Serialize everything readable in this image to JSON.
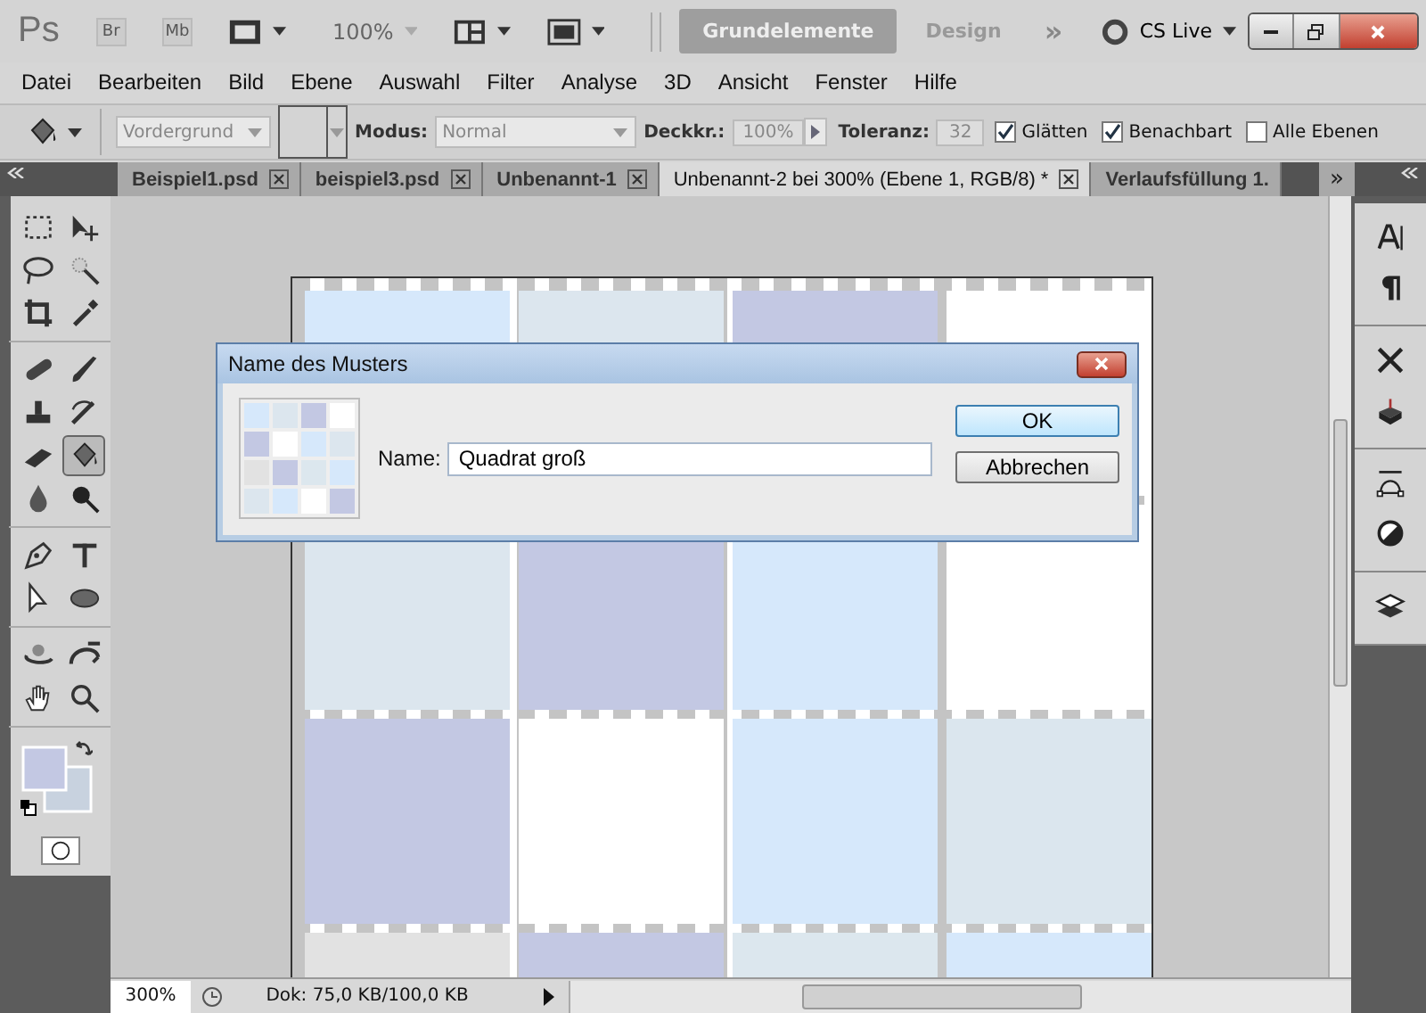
{
  "app_bar": {
    "logo": "Ps",
    "bridge": "Br",
    "mini_bridge": "Mb",
    "zoom": "100%",
    "workspaces": [
      {
        "label": "Grundelemente",
        "selected": true
      },
      {
        "label": "Design",
        "selected": false
      }
    ],
    "more": "»",
    "cs_live": "CS Live"
  },
  "menu": [
    "Datei",
    "Bearbeiten",
    "Bild",
    "Ebene",
    "Auswahl",
    "Filter",
    "Analyse",
    "3D",
    "Ansicht",
    "Fenster",
    "Hilfe"
  ],
  "options": {
    "fill_source": "Vordergrund",
    "mode_label": "Modus:",
    "mode": "Normal",
    "opacity_label": "Deckkr.:",
    "opacity": "100%",
    "tolerance_label": "Toleranz:",
    "tolerance": "32",
    "checkboxes": [
      {
        "label": "Glätten",
        "checked": true
      },
      {
        "label": "Benachbart",
        "checked": true
      },
      {
        "label": "Alle Ebenen",
        "checked": false
      }
    ]
  },
  "tabs": [
    {
      "label": "Beispiel1.psd",
      "selected": false,
      "closable": true
    },
    {
      "label": "beispiel3.psd",
      "selected": false,
      "closable": true
    },
    {
      "label": "Unbenannt-1",
      "selected": false,
      "closable": true
    },
    {
      "label": "Unbenannt-2 bei 300% (Ebene 1, RGB/8) *",
      "selected": true,
      "closable": true
    },
    {
      "label": "Verlaufsfüllung 1.",
      "selected": false,
      "closable": false
    }
  ],
  "tab_overflow": "»",
  "tools": [
    {
      "kind": "marquee",
      "selected": false
    },
    {
      "kind": "move",
      "selected": false
    },
    {
      "kind": "lasso",
      "selected": false
    },
    {
      "kind": "wand",
      "selected": false
    },
    {
      "kind": "crop",
      "selected": false
    },
    {
      "kind": "eyedropper",
      "selected": false
    },
    {
      "kind": "heal",
      "selected": false
    },
    {
      "kind": "brush",
      "selected": false
    },
    {
      "kind": "stamp",
      "selected": false
    },
    {
      "kind": "history",
      "selected": false
    },
    {
      "kind": "eraser",
      "selected": false
    },
    {
      "kind": "bucket",
      "selected": true
    },
    {
      "kind": "blur",
      "selected": false
    },
    {
      "kind": "dodge",
      "selected": false
    },
    {
      "kind": "pen",
      "selected": false
    },
    {
      "kind": "type",
      "selected": false
    },
    {
      "kind": "path",
      "selected": false
    },
    {
      "kind": "ellipse",
      "selected": false
    },
    {
      "kind": "rotate3d",
      "selected": false
    },
    {
      "kind": "orbit3d",
      "selected": false
    },
    {
      "kind": "hand",
      "selected": false
    },
    {
      "kind": "zoom",
      "selected": false
    }
  ],
  "dialog": {
    "title": "Name des Musters",
    "field_label": "Name:",
    "value": "Quadrat groß",
    "buttons": [
      {
        "label": "OK",
        "default": true
      },
      {
        "label": "Abbrechen",
        "default": false
      }
    ]
  },
  "status": {
    "zoom": "300%",
    "doc": "Dok: 75,0 KB/100,0 KB"
  }
}
